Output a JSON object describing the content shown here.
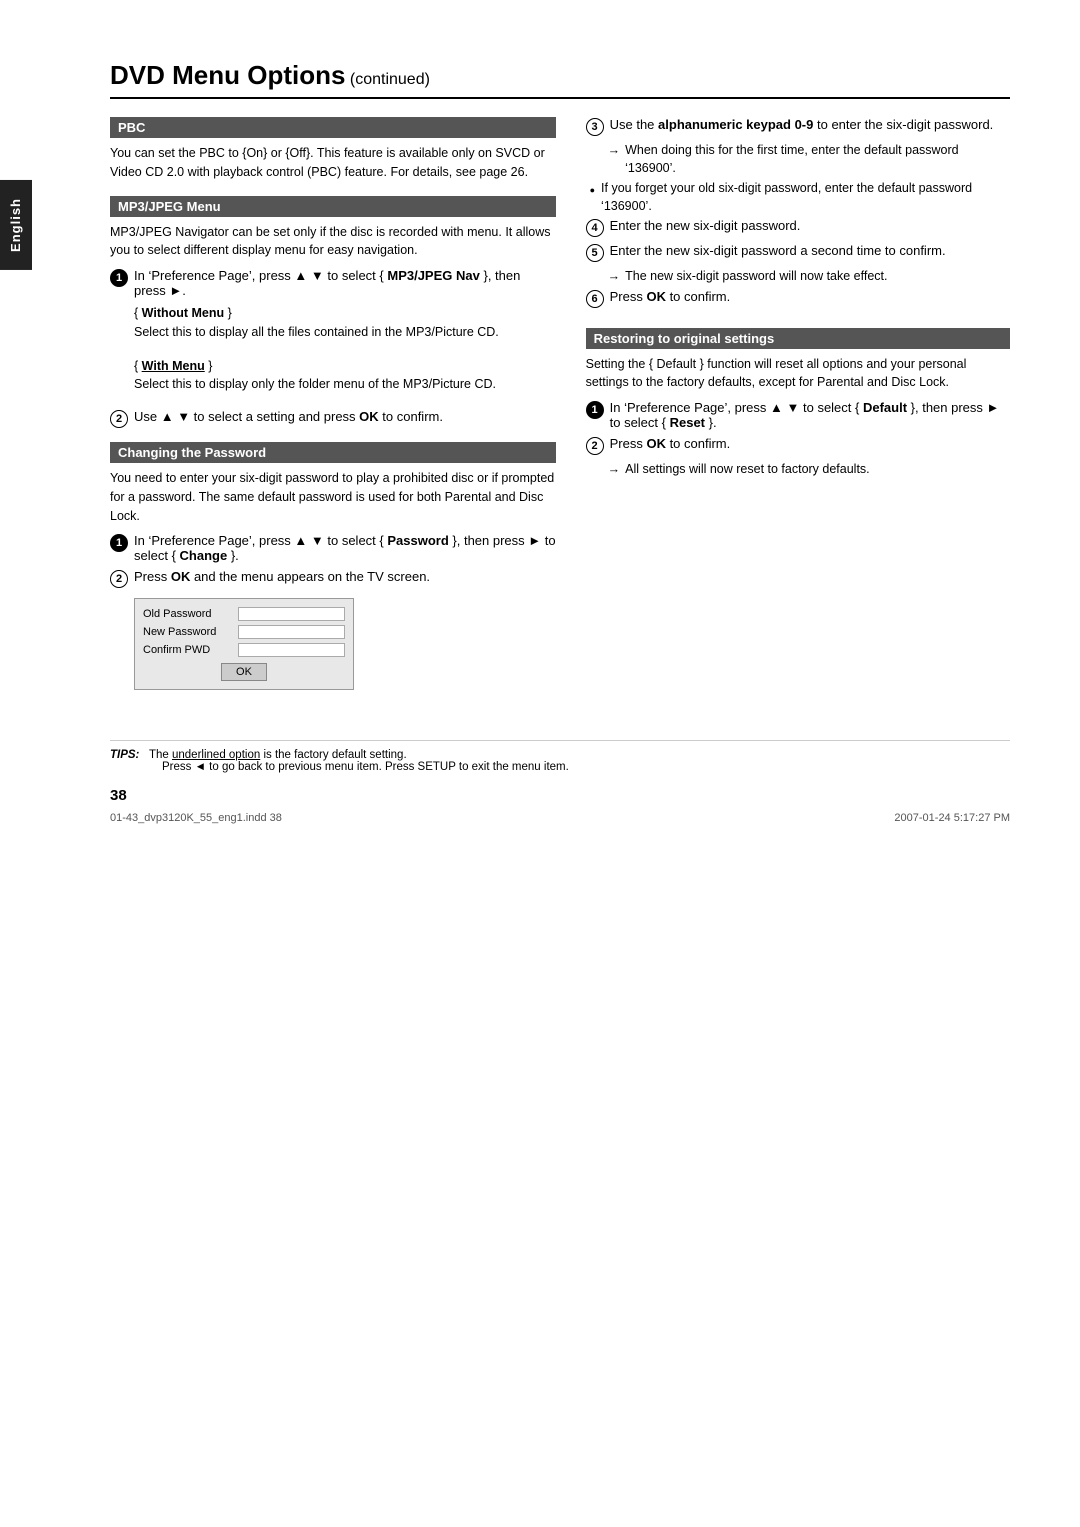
{
  "page": {
    "title": "DVD Menu Options",
    "title_continued": " (continued)",
    "english_tab": "English",
    "page_number": "38",
    "footer_file_left": "01-43_dvp3120K_55_eng1.indd  38",
    "footer_file_right": "2007-01-24  5:17:27 PM"
  },
  "sections": {
    "pbc": {
      "header": "PBC",
      "body": "You can set the PBC to {On} or {Off}. This feature is available only on SVCD or Video CD 2.0 with playback control (PBC) feature. For details, see page 26."
    },
    "mp3jpeg": {
      "header": "MP3/JPEG Menu",
      "body": "MP3/JPEG Navigator can be set only if the disc is recorded with menu. It allows you to select different display menu for easy navigation.",
      "step1": "In ‘Preference Page’, press ▲ ▼ to select { MP3/JPEG Nav }, then press ►.",
      "without_menu_label": "{ Without Menu }",
      "without_menu_body": "Select this to display all the files contained in the MP3/Picture CD.",
      "with_menu_label": "{ With Menu }",
      "with_menu_body": "Select this to display only the folder menu of the MP3/Picture CD.",
      "step2": "Use ▲ ▼ to select a setting and press OK to confirm."
    },
    "password": {
      "header": "Changing the Password",
      "body": "You need to enter your six-digit password to play a prohibited disc or if prompted for a password. The same default password is used for both Parental and Disc Lock.",
      "step1": "In ‘Preference Page’, press ▲ ▼ to select { Password }, then press ► to select { Change }.",
      "step2": "Press OK and the menu appears on the TV screen.",
      "dialog": {
        "old_password_label": "Old Password",
        "new_password_label": "New Password",
        "confirm_pwd_label": "Confirm PWD",
        "ok_btn": "OK"
      }
    },
    "right_col": {
      "step3_prefix": "Use the ",
      "step3_bold": "alphanumeric keypad 0-9",
      "step3_suffix": " to enter the six-digit password.",
      "step3_arrow1": "When doing this for the first time, enter the default password ‘136900’.",
      "step3_bullet": "If you forget your old six-digit password, enter the default password ‘136900’.",
      "step4": "Enter the new six-digit password.",
      "step5": "Enter the new six-digit password a second time to confirm.",
      "step5_arrow": "The new six-digit password will now take effect.",
      "step6": "Press OK to confirm."
    },
    "restore": {
      "header": "Restoring to original settings",
      "body": "Setting the { Default } function will reset all options and your personal settings to the factory defaults, except for Parental and Disc Lock.",
      "step1": "In ‘Preference Page’, press ▲ ▼ to select { Default }, then press ► to select { Reset }.",
      "step2": "Press OK to confirm.",
      "step2_arrow": "All settings will now reset to factory defaults."
    }
  },
  "tips": {
    "label": "TIPS:",
    "line1_prefix": "The ",
    "line1_underlined": "underlined option",
    "line1_suffix": " is the factory default setting.",
    "line2": "Press ◄ to go back to previous menu item. Press SETUP to exit the menu item."
  }
}
